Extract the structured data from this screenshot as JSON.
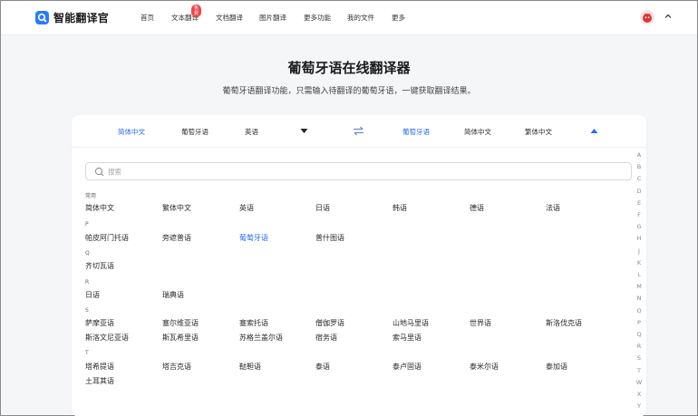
{
  "brand": {
    "name": "智能翻译官",
    "accent": "#2a7cf6"
  },
  "nav": [
    {
      "label": "首页"
    },
    {
      "label": "文本翻译",
      "badge": "免费"
    },
    {
      "label": "文档翻译"
    },
    {
      "label": "图片翻译"
    },
    {
      "label": "更多功能"
    },
    {
      "label": "我的文件"
    },
    {
      "label": "更多"
    }
  ],
  "hero": {
    "title": "葡萄牙语在线翻译器",
    "subtitle": "葡萄牙语翻译功能，只需输入待翻译的葡萄牙语，一键获取翻译结果。"
  },
  "source_langs": [
    "简体中文",
    "葡萄牙语",
    "英语"
  ],
  "target_langs": [
    "葡萄牙语",
    "简体中文",
    "繁体中文"
  ],
  "search": {
    "placeholder": "搜索"
  },
  "sections": [
    {
      "head": "常用",
      "items": [
        "简体中文",
        "繁体中文",
        "英语",
        "日语",
        "韩语",
        "德语",
        "法语"
      ]
    },
    {
      "head": "P",
      "items": [
        "帕皮阿门托语",
        "旁遮普语",
        "葡萄牙语",
        "普什图语"
      ]
    },
    {
      "head": "Q",
      "items": [
        "齐切瓦语"
      ]
    },
    {
      "head": "R",
      "items": [
        "日语",
        "瑞典语"
      ]
    },
    {
      "head": "S",
      "items": [
        "萨摩亚语",
        "塞尔维亚语",
        "塞索托语",
        "僧伽罗语",
        "山地马里语",
        "世界语",
        "斯洛伐克语",
        "斯洛文尼亚语",
        "斯瓦希里语",
        "苏格兰盖尔语",
        "宿务语",
        "索马里语"
      ]
    },
    {
      "head": "T",
      "items": [
        "塔希提语",
        "塔吉克语",
        "鞑靼语",
        "泰语",
        "泰卢固语",
        "泰米尔语",
        "泰加语",
        "土耳其语"
      ]
    }
  ],
  "selected_language": "葡萄牙语",
  "alphabet": [
    "A",
    "B",
    "C",
    "D",
    "E",
    "F",
    "G",
    "H",
    "J",
    "K",
    "L",
    "M",
    "N",
    "O",
    "P",
    "Q",
    "R",
    "S",
    "T",
    "W",
    "X",
    "Y"
  ]
}
